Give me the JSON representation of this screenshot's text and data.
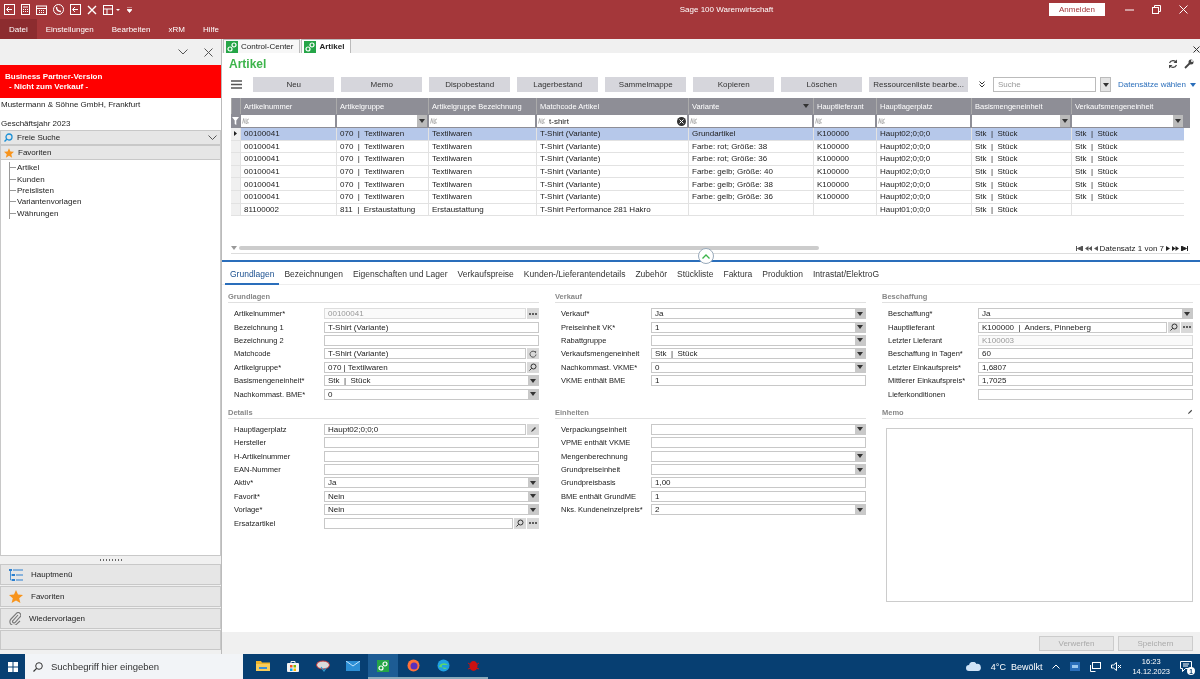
{
  "titlebar": {
    "title": "Sage 100 Warenwirtschaft",
    "login_button": "Anmelden"
  },
  "menu": [
    {
      "label": "Datei",
      "selected": true
    },
    {
      "label": "Einstellungen",
      "selected": false
    },
    {
      "label": "Bearbeiten",
      "selected": false
    },
    {
      "label": "xRM",
      "selected": false
    },
    {
      "label": "Hilfe",
      "selected": false
    }
  ],
  "sidebar": {
    "banner_lines": [
      "Business Partner-Version",
      "- Nicht zum Verkauf -"
    ],
    "company": "Mustermann & Söhne GmbH, Frankfurt",
    "fiscal_year": "Geschäftsjahr 2023",
    "search": {
      "label": "Freie Suche"
    },
    "favorites": {
      "label": "Favoriten",
      "children": [
        {
          "label": "Artikel"
        },
        {
          "label": "Kunden"
        },
        {
          "label": "Preislisten"
        },
        {
          "label": "Variantenvorlagen"
        },
        {
          "label": "Währungen"
        }
      ]
    },
    "nav": [
      {
        "label": "Hauptmenü",
        "kind": "menu"
      },
      {
        "label": "Favoriten",
        "kind": "star"
      },
      {
        "label": "Wiedervorlagen",
        "kind": "clip"
      }
    ]
  },
  "doc_tabs": [
    {
      "label": "Control-Center",
      "selected": false
    },
    {
      "label": "Artikel",
      "selected": true
    }
  ],
  "page_title": "Artikel",
  "toolbar": {
    "buttons": [
      "Neu",
      "Memo",
      "Dispobestand",
      "Lagerbestand",
      "Sammelmappe",
      "Kopieren",
      "Löschen",
      "Ressourcenliste bearbe..."
    ],
    "search": {
      "placeholder": "Suche"
    },
    "select_link": "Datensätze wählen"
  },
  "table": {
    "columns": [
      {
        "label": "Artikelnummer",
        "kind": "text",
        "menu": false
      },
      {
        "label": "Artikelgruppe",
        "kind": "select",
        "menu": false
      },
      {
        "label": "Artikelgruppe Bezeichnung",
        "kind": "text",
        "menu": false
      },
      {
        "label": "Matchcode Artikel",
        "kind": "text",
        "filter_value": "t-shirt",
        "menu": false
      },
      {
        "label": "Variante",
        "kind": "text",
        "menu": true
      },
      {
        "label": "Hauptlieferant",
        "kind": "text",
        "menu": false
      },
      {
        "label": "Hauptlagerplatz",
        "kind": "text",
        "menu": false
      },
      {
        "label": "Basismengeneinheit",
        "kind": "select",
        "menu": false
      },
      {
        "label": "Verkaufsmengeneinheit",
        "kind": "select",
        "menu": false
      }
    ],
    "rows": [
      {
        "selected": true,
        "cells": [
          "00100041",
          "070  |  Textilwaren",
          "Textilwaren",
          "T-Shirt (Variante)",
          "Grundartikel",
          "K100000",
          "Haupt02;0;0;0",
          "Stk  |  Stück",
          "Stk  |  Stück"
        ]
      },
      {
        "selected": false,
        "cells": [
          "00100041",
          "070  |  Textilwaren",
          "Textilwaren",
          "T-Shirt (Variante)",
          "Farbe: rot; Größe: 38",
          "K100000",
          "Haupt02;0;0;0",
          "Stk  |  Stück",
          "Stk  |  Stück"
        ]
      },
      {
        "selected": false,
        "cells": [
          "00100041",
          "070  |  Textilwaren",
          "Textilwaren",
          "T-Shirt (Variante)",
          "Farbe: rot; Größe: 36",
          "K100000",
          "Haupt02;0;0;0",
          "Stk  |  Stück",
          "Stk  |  Stück"
        ]
      },
      {
        "selected": false,
        "cells": [
          "00100041",
          "070  |  Textilwaren",
          "Textilwaren",
          "T-Shirt (Variante)",
          "Farbe: gelb; Größe: 40",
          "K100000",
          "Haupt02;0;0;0",
          "Stk  |  Stück",
          "Stk  |  Stück"
        ]
      },
      {
        "selected": false,
        "cells": [
          "00100041",
          "070  |  Textilwaren",
          "Textilwaren",
          "T-Shirt (Variante)",
          "Farbe: gelb; Größe: 38",
          "K100000",
          "Haupt02;0;0;0",
          "Stk  |  Stück",
          "Stk  |  Stück"
        ]
      },
      {
        "selected": false,
        "cells": [
          "00100041",
          "070  |  Textilwaren",
          "Textilwaren",
          "T-Shirt (Variante)",
          "Farbe: gelb; Größe: 36",
          "K100000",
          "Haupt02;0;0;0",
          "Stk  |  Stück",
          "Stk  |  Stück"
        ]
      },
      {
        "selected": false,
        "cells": [
          "81100002",
          "811  |  Erstaustattung",
          "Erstaustattung",
          "T-Shirt Performance 281 Hakro",
          "",
          "",
          "Haupt01;0;0;0",
          "Stk  |  Stück",
          ""
        ]
      }
    ],
    "pager": "Datensatz 1 von 7"
  },
  "detail_tabs": [
    {
      "label": "Grundlagen",
      "selected": true
    },
    {
      "label": "Bezeichnungen",
      "selected": false
    },
    {
      "label": "Eigenschaften und Lager",
      "selected": false
    },
    {
      "label": "Verkaufspreise",
      "selected": false
    },
    {
      "label": "Kunden-/Lieferantendetails",
      "selected": false
    },
    {
      "label": "Zubehör",
      "selected": false
    },
    {
      "label": "Stückliste",
      "selected": false
    },
    {
      "label": "Faktura",
      "selected": false
    },
    {
      "label": "Produktion",
      "selected": false
    },
    {
      "label": "Intrastat/ElektroG",
      "selected": false
    }
  ],
  "sections": [
    {
      "title": "Grundlagen",
      "kind": "form",
      "fields": [
        {
          "label": "Artikelnummer*",
          "value": "00100041",
          "kind": "more",
          "readonly": true
        },
        {
          "label": "Bezeichnung 1",
          "value": "T-Shirt (Variante)",
          "kind": "text",
          "readonly": false
        },
        {
          "label": "Bezeichnung 2",
          "kind": "text",
          "readonly": false
        },
        {
          "label": "Matchcode",
          "value": "T-Shirt (Variante)",
          "kind": "reload",
          "readonly": false
        },
        {
          "label": "Artikelgruppe*",
          "value": "070 | Textilwaren",
          "kind": "search",
          "readonly": false
        },
        {
          "label": "Basismengeneinheit*",
          "value": "Stk  |  Stück",
          "kind": "select",
          "readonly": false
        },
        {
          "label": "Nachkommast. BME*",
          "value": "0",
          "kind": "select",
          "readonly": false
        }
      ]
    },
    {
      "title": "Verkauf",
      "kind": "form",
      "fields": [
        {
          "label": "Verkauf*",
          "value": "Ja",
          "kind": "select",
          "readonly": false
        },
        {
          "label": "Preiseinheit VK*",
          "value": "1",
          "kind": "select",
          "readonly": false
        },
        {
          "label": "Rabattgruppe",
          "kind": "select",
          "readonly": false
        },
        {
          "label": "Verkaufsmengeneinheit",
          "value": "Stk  |  Stück",
          "kind": "select",
          "readonly": false
        },
        {
          "label": "Nachkommast. VKME*",
          "value": "0",
          "kind": "select",
          "readonly": false
        },
        {
          "label": "VKME enthält BME",
          "value": "1",
          "kind": "text",
          "readonly": false
        }
      ]
    },
    {
      "title": "Beschaffung",
      "kind": "form",
      "fields": [
        {
          "label": "Beschaffung*",
          "value": "Ja",
          "kind": "select",
          "readonly": false
        },
        {
          "label": "Hauptlieferant",
          "value": "K100000  |  Anders, Pinneberg",
          "kind": "search-more",
          "readonly": false
        },
        {
          "label": "Letzter Lieferant",
          "value": "K100003",
          "kind": "text",
          "readonly": true
        },
        {
          "label": "Beschaffung in Tagen*",
          "value": "60",
          "kind": "text",
          "readonly": false
        },
        {
          "label": "Letzter Einkaufspreis*",
          "value": "1,6807",
          "kind": "text",
          "readonly": false
        },
        {
          "label": "Mittlerer Einkaufspreis*",
          "value": "1,7025",
          "kind": "text",
          "readonly": false
        },
        {
          "label": "Lieferkonditionen",
          "kind": "text",
          "readonly": false
        }
      ]
    },
    {
      "title": "Details",
      "kind": "form",
      "fields": [
        {
          "label": "Hauptlagerplatz",
          "value": "Haupt02;0;0;0",
          "kind": "edit",
          "readonly": false
        },
        {
          "label": "Hersteller",
          "kind": "text",
          "readonly": false
        },
        {
          "label": "H-Artikelnummer",
          "kind": "text",
          "readonly": false
        },
        {
          "label": "EAN-Nummer",
          "kind": "text",
          "readonly": false
        },
        {
          "label": "Aktiv*",
          "value": "Ja",
          "kind": "select",
          "readonly": false
        },
        {
          "label": "Favorit*",
          "value": "Nein",
          "kind": "select",
          "readonly": false
        },
        {
          "label": "Vorlage*",
          "value": "Nein",
          "kind": "select",
          "readonly": false
        },
        {
          "label": "Ersatzartikel",
          "kind": "search-more",
          "readonly": false
        }
      ]
    },
    {
      "title": "Einheiten",
      "kind": "form",
      "fields": [
        {
          "label": "Verpackungseinheit",
          "kind": "select",
          "readonly": false
        },
        {
          "label": "VPME enthält VKME",
          "kind": "text",
          "readonly": false
        },
        {
          "label": "Mengenberechnung",
          "kind": "select",
          "readonly": false
        },
        {
          "label": "Grundpreiseinheit",
          "kind": "select",
          "readonly": false
        },
        {
          "label": "Grundpreisbasis",
          "value": "1,00",
          "kind": "text",
          "readonly": false
        },
        {
          "label": "BME enthält GrundME",
          "value": "1",
          "kind": "text",
          "readonly": false
        },
        {
          "label": "Nks. Kundeneinzelpreis*",
          "value": "2",
          "kind": "select",
          "readonly": false
        }
      ]
    },
    {
      "title": "Memo",
      "kind": "memo"
    }
  ],
  "footer_buttons": [
    {
      "label": "Verwerfen",
      "disabled": true
    },
    {
      "label": "Speichern",
      "disabled": true
    }
  ],
  "taskbar": {
    "search": {
      "placeholder": "Suchbegriff hier eingeben"
    },
    "apps": [
      {
        "kind": "folder",
        "selected": false,
        "running": false
      },
      {
        "kind": "store",
        "selected": false,
        "running": false
      },
      {
        "kind": "disc",
        "selected": false,
        "running": false
      },
      {
        "kind": "mail",
        "selected": false,
        "running": false
      },
      {
        "kind": "sage",
        "selected": true,
        "running": true
      },
      {
        "kind": "fox",
        "selected": false,
        "running": true
      },
      {
        "kind": "edge",
        "selected": false,
        "running": true
      },
      {
        "kind": "bug",
        "selected": false,
        "running": true
      }
    ],
    "weather": "4°C  Bewölkt",
    "time": "16:23",
    "date": "14.12.2023",
    "notifications": "1"
  }
}
